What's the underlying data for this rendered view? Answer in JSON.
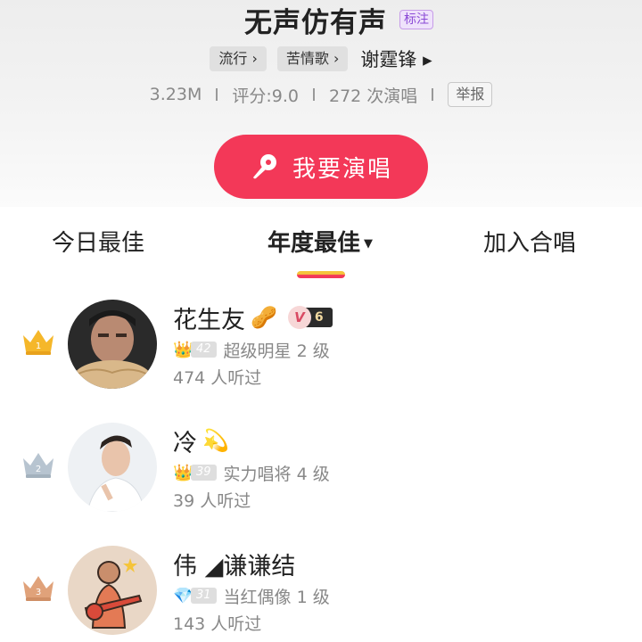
{
  "song": {
    "title": "无声仿有声",
    "label_tag": "标注",
    "genre_tags": [
      "流行 ›",
      "苦情歌 ›"
    ],
    "artist": "谢霆锋 ▸",
    "stats": {
      "plays": "3.23M",
      "rating": "评分:9.0",
      "performances": "272 次演唱",
      "report": "举报"
    },
    "sing_button": "我要演唱"
  },
  "tabs": [
    {
      "label": "今日最佳"
    },
    {
      "label": "年度最佳",
      "caret": "▼",
      "active": true
    },
    {
      "label": "加入合唱"
    }
  ],
  "ranking": [
    {
      "rank": "1",
      "name": "花生友",
      "emoji": "🥜",
      "vip_letter": "V",
      "vip_level": "6",
      "level_icon": "👑",
      "level_num": "42",
      "level_title": "超级明星 2 级",
      "listens": "474 人听过"
    },
    {
      "rank": "2",
      "name": "冷",
      "emoji": "💫",
      "level_icon": "👑",
      "level_num": "39",
      "level_title": "实力唱将 4 级",
      "listens": "39 人听过"
    },
    {
      "rank": "3",
      "name": "伟 ◢谦谦结",
      "emoji": "",
      "level_icon": "💎",
      "level_num": "31",
      "level_title": "当红偶像 1 级",
      "listens": "143 人听过"
    }
  ],
  "colors": {
    "accent": "#f33858",
    "gold": "#f5b72a",
    "silver": "#b7c4d0",
    "bronze": "#e0a27a"
  }
}
